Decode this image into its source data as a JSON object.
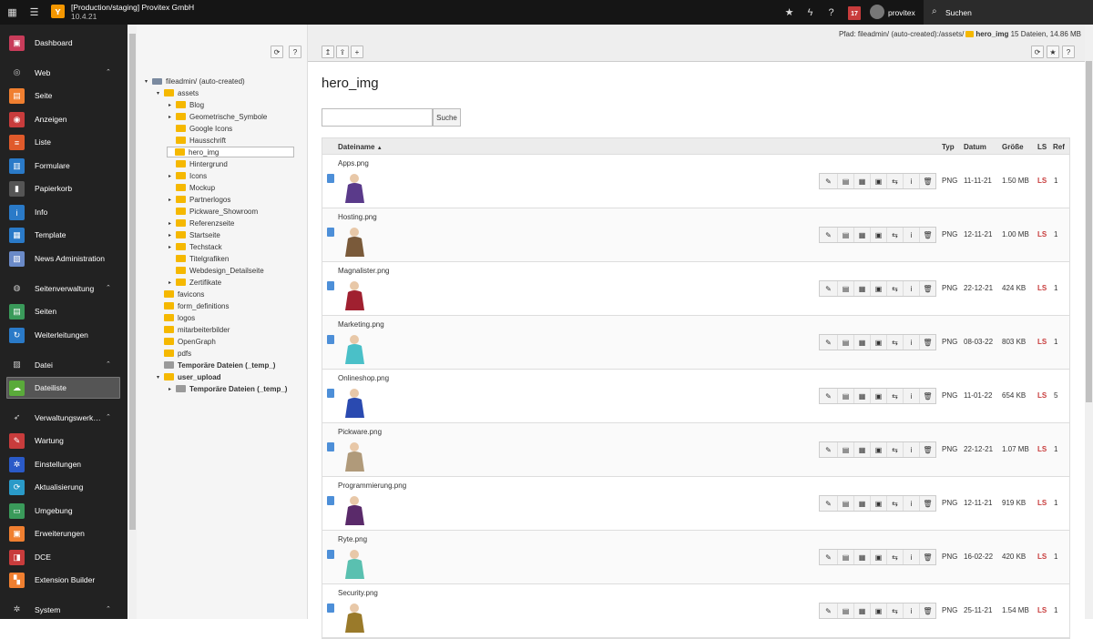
{
  "topbar": {
    "site_title": "[Production/staging] Provitex GmbH",
    "version": "10.4.21",
    "calendar_day": "17",
    "username": "provitex",
    "search_label": "Suchen"
  },
  "sidebar": {
    "items": [
      {
        "label": "Dashboard",
        "icon": "dashboard-icon",
        "color": "#c83c5a",
        "group": false
      },
      {
        "label": "Web",
        "icon": "web-icon",
        "group": true
      },
      {
        "label": "Seite",
        "icon": "page-icon",
        "color": "#f07f30",
        "group": false
      },
      {
        "label": "Anzeigen",
        "icon": "eye-icon",
        "color": "#c83c3c",
        "group": false
      },
      {
        "label": "Liste",
        "icon": "list-icon",
        "color": "#e05a2b",
        "group": false
      },
      {
        "label": "Formulare",
        "icon": "form-icon",
        "color": "#2a7ac8",
        "group": false
      },
      {
        "label": "Papierkorb",
        "icon": "trash-icon",
        "color": "#555",
        "group": false
      },
      {
        "label": "Info",
        "icon": "info-icon",
        "color": "#2a7ac8",
        "group": false
      },
      {
        "label": "Template",
        "icon": "template-icon",
        "color": "#2a7ac8",
        "group": false
      },
      {
        "label": "News Administration",
        "icon": "news-icon",
        "color": "#6a8ac8",
        "group": false
      },
      {
        "label": "Seitenverwaltung",
        "icon": "globe-icon",
        "group": true
      },
      {
        "label": "Seiten",
        "icon": "pages-icon",
        "color": "#3a9a5a",
        "group": false
      },
      {
        "label": "Weiterleitungen",
        "icon": "redirect-icon",
        "color": "#2a7ac8",
        "group": false
      },
      {
        "label": "Datei",
        "icon": "image-icon",
        "group": true
      },
      {
        "label": "Dateiliste",
        "icon": "cloud-icon",
        "color": "#5aaa3a",
        "group": false,
        "active": true
      },
      {
        "label": "Verwaltungswerk…",
        "icon": "rocket-icon",
        "group": true
      },
      {
        "label": "Wartung",
        "icon": "wrench-icon",
        "color": "#c83c3c",
        "group": false
      },
      {
        "label": "Einstellungen",
        "icon": "gear-icon",
        "color": "#2a5ac8",
        "group": false
      },
      {
        "label": "Aktualisierung",
        "icon": "refresh-icon",
        "color": "#2a9ac8",
        "group": false
      },
      {
        "label": "Umgebung",
        "icon": "monitor-icon",
        "color": "#3a9a5a",
        "group": false
      },
      {
        "label": "Erweiterungen",
        "icon": "box-icon",
        "color": "#f07f30",
        "group": false
      },
      {
        "label": "DCE",
        "icon": "dce-icon",
        "color": "#c83c3c",
        "group": false
      },
      {
        "label": "Extension Builder",
        "icon": "builder-icon",
        "color": "#f07f30",
        "group": false
      },
      {
        "label": "System",
        "icon": "settings-icon",
        "group": true
      }
    ]
  },
  "tree": {
    "root": "fileadmin/ (auto-created)",
    "nodes": [
      {
        "label": "assets",
        "level": 1,
        "toggle": "open"
      },
      {
        "label": "Blog",
        "level": 2,
        "toggle": "closed"
      },
      {
        "label": "Geometrische_Symbole",
        "level": 2,
        "toggle": "closed"
      },
      {
        "label": "Google Icons",
        "level": 2,
        "toggle": ""
      },
      {
        "label": "Hausschrift",
        "level": 2,
        "toggle": ""
      },
      {
        "label": "hero_img",
        "level": 2,
        "toggle": "",
        "selected": true
      },
      {
        "label": "Hintergrund",
        "level": 2,
        "toggle": ""
      },
      {
        "label": "Icons",
        "level": 2,
        "toggle": "closed"
      },
      {
        "label": "Mockup",
        "level": 2,
        "toggle": ""
      },
      {
        "label": "Partnerlogos",
        "level": 2,
        "toggle": "closed"
      },
      {
        "label": "Pickware_Showroom",
        "level": 2,
        "toggle": ""
      },
      {
        "label": "Referenzseite",
        "level": 2,
        "toggle": "closed"
      },
      {
        "label": "Startseite",
        "level": 2,
        "toggle": "closed"
      },
      {
        "label": "Techstack",
        "level": 2,
        "toggle": "closed"
      },
      {
        "label": "Titelgrafiken",
        "level": 2,
        "toggle": ""
      },
      {
        "label": "Webdesign_Detailseite",
        "level": 2,
        "toggle": ""
      },
      {
        "label": "Zertifikate",
        "level": 2,
        "toggle": "closed"
      },
      {
        "label": "favicons",
        "level": 1,
        "toggle": ""
      },
      {
        "label": "form_definitions",
        "level": 1,
        "toggle": ""
      },
      {
        "label": "logos",
        "level": 1,
        "toggle": ""
      },
      {
        "label": "mitarbeiterbilder",
        "level": 1,
        "toggle": ""
      },
      {
        "label": "OpenGraph",
        "level": 1,
        "toggle": ""
      },
      {
        "label": "pdfs",
        "level": 1,
        "toggle": ""
      },
      {
        "label": "Temporäre Dateien (_temp_)",
        "level": 1,
        "toggle": "",
        "bold": true,
        "grey": true
      },
      {
        "label": "user_upload",
        "level": 1,
        "toggle": "open",
        "bold": true
      },
      {
        "label": "Temporäre Dateien (_temp_)",
        "level": 2,
        "toggle": "closed",
        "bold": true,
        "grey": true
      }
    ]
  },
  "header": {
    "path_label": "Pfad: fileadmin/ (auto-created):/assets/",
    "path_folder": "hero_img",
    "path_stats": "15 Dateien, 14.86 MB"
  },
  "main": {
    "title": "hero_img",
    "search_button": "Suche",
    "columns": {
      "name": "Dateiname",
      "type": "Typ",
      "date": "Datum",
      "size": "Größe",
      "ls": "LS",
      "ref": "Ref"
    },
    "files": [
      {
        "name": "Apps.png",
        "type": "PNG",
        "date": "11-11-21",
        "size": "1.50 MB",
        "ls": "LS",
        "ref": "1",
        "thumb_color": "#5a3a8a"
      },
      {
        "name": "Hosting.png",
        "type": "PNG",
        "date": "12-11-21",
        "size": "1.00 MB",
        "ls": "LS",
        "ref": "1",
        "thumb_color": "#7a5a3a"
      },
      {
        "name": "Magnalister.png",
        "type": "PNG",
        "date": "22-12-21",
        "size": "424 KB",
        "ls": "LS",
        "ref": "1",
        "thumb_color": "#a02030"
      },
      {
        "name": "Marketing.png",
        "type": "PNG",
        "date": "08-03-22",
        "size": "803 KB",
        "ls": "LS",
        "ref": "1",
        "thumb_color": "#4ac0c8"
      },
      {
        "name": "Onlineshop.png",
        "type": "PNG",
        "date": "11-01-22",
        "size": "654 KB",
        "ls": "LS",
        "ref": "5",
        "thumb_color": "#2a4ab0"
      },
      {
        "name": "Pickware.png",
        "type": "PNG",
        "date": "22-12-21",
        "size": "1.07 MB",
        "ls": "LS",
        "ref": "1",
        "thumb_color": "#b09a7a"
      },
      {
        "name": "Programmierung.png",
        "type": "PNG",
        "date": "12-11-21",
        "size": "919 KB",
        "ls": "LS",
        "ref": "1",
        "thumb_color": "#5a2a6a"
      },
      {
        "name": "Ryte.png",
        "type": "PNG",
        "date": "16-02-22",
        "size": "420 KB",
        "ls": "LS",
        "ref": "1",
        "thumb_color": "#5ac0b0"
      },
      {
        "name": "Security.png",
        "type": "PNG",
        "date": "25-11-21",
        "size": "1.54 MB",
        "ls": "LS",
        "ref": "1",
        "thumb_color": "#9a7a2a"
      }
    ]
  }
}
